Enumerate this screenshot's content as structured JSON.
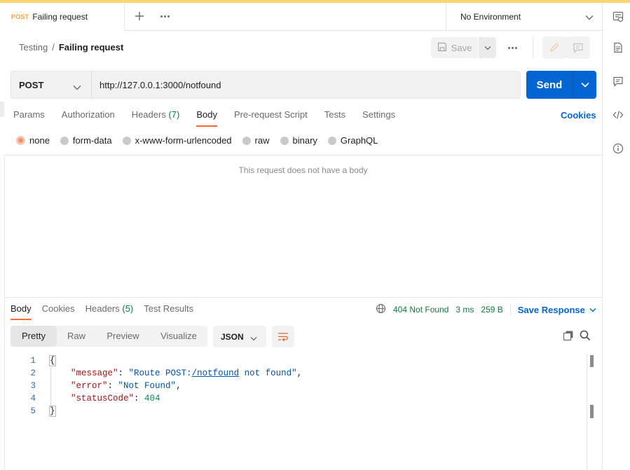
{
  "tab": {
    "method": "POST",
    "title": "Failing request"
  },
  "environment": {
    "label": "No Environment"
  },
  "breadcrumb": {
    "parent": "Testing",
    "separator": "/",
    "current": "Failing request"
  },
  "toolbar": {
    "save_label": "Save"
  },
  "request": {
    "method": "POST",
    "url": "http://127.0.0.1:3000/notfound",
    "send_label": "Send"
  },
  "request_tabs": [
    {
      "label": "Params"
    },
    {
      "label": "Authorization"
    },
    {
      "label": "Headers",
      "count": "(7)"
    },
    {
      "label": "Body",
      "active": true
    },
    {
      "label": "Pre-request Script"
    },
    {
      "label": "Tests"
    },
    {
      "label": "Settings"
    }
  ],
  "cookies_label": "Cookies",
  "body_types": [
    {
      "label": "none",
      "selected": true
    },
    {
      "label": "form-data"
    },
    {
      "label": "x-www-form-urlencoded"
    },
    {
      "label": "raw"
    },
    {
      "label": "binary"
    },
    {
      "label": "GraphQL"
    }
  ],
  "no_body_text": "This request does not have a body",
  "response_tabs": [
    {
      "label": "Body",
      "active": true
    },
    {
      "label": "Cookies"
    },
    {
      "label": "Headers",
      "count": "(5)"
    },
    {
      "label": "Test Results"
    }
  ],
  "response_meta": {
    "status": "404 Not Found",
    "time": "3 ms",
    "size": "259 B",
    "save_response": "Save Response"
  },
  "view_modes": [
    {
      "label": "Pretty",
      "active": true
    },
    {
      "label": "Raw"
    },
    {
      "label": "Preview"
    },
    {
      "label": "Visualize"
    }
  ],
  "format": "JSON",
  "code_lines": [
    {
      "num": "1",
      "text": "{"
    },
    {
      "num": "2",
      "key": "\"message\"",
      "value_prefix": "\"Route POST:",
      "value_link": "/notfound",
      "value_suffix": " not found\"",
      "trail": ","
    },
    {
      "num": "3",
      "key": "\"error\"",
      "value": "\"Not Found\"",
      "trail": ","
    },
    {
      "num": "4",
      "key": "\"statusCode\"",
      "number": "404"
    },
    {
      "num": "5",
      "text": "}"
    }
  ],
  "colors": {
    "accent": "#ff6c37",
    "primary": "#0265d2",
    "success": "#0f7b3a",
    "method_post": "#f0a43a"
  },
  "icons": [
    "plus-icon",
    "more-icon",
    "chevron-down-icon",
    "api-icon",
    "document-icon",
    "comment-icon",
    "code-icon",
    "info-icon",
    "save-icon",
    "edit-icon",
    "globe-icon",
    "wrap-lines-icon",
    "copy-icon",
    "search-icon"
  ]
}
